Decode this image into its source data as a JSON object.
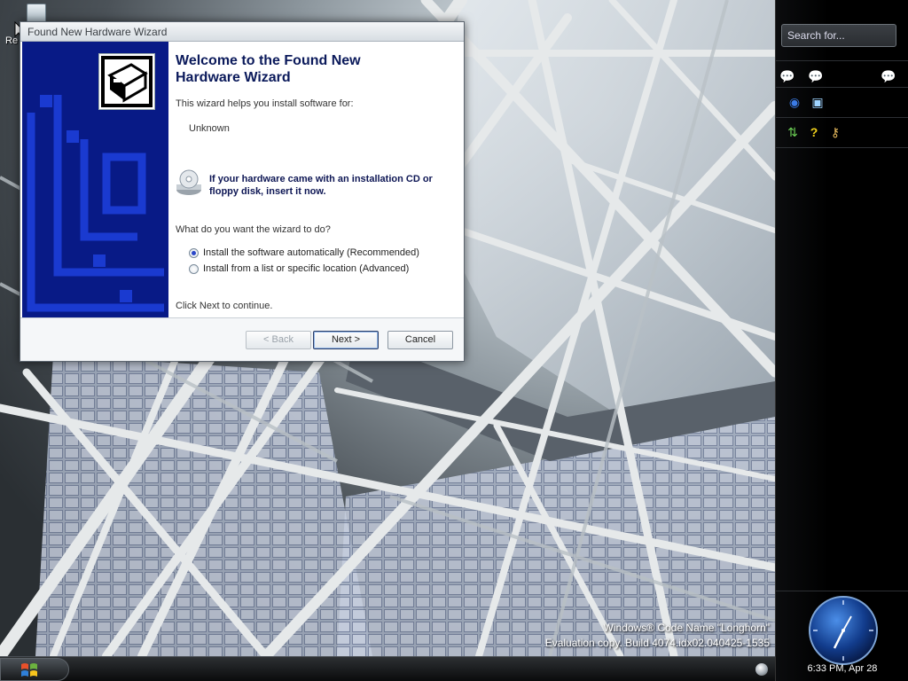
{
  "desktop": {
    "recycle_bin_label": "Re",
    "watermark_line1": "Windows® Code Name \"Longhorn\"",
    "watermark_line2": "Evaluation copy. Build 4074.idx02.040425-1535"
  },
  "wizard": {
    "window_title": "Found New Hardware Wizard",
    "heading": "Welcome to the Found New Hardware Wizard",
    "intro": "This wizard helps you install software for:",
    "device_name": "Unknown",
    "cd_hint": "If your hardware came with an installation CD or floppy disk, insert it now.",
    "question": "What do you want the wizard to do?",
    "options": [
      {
        "label": "Install the software automatically (Recommended)",
        "selected": true
      },
      {
        "label": "Install from a list or specific location (Advanced)",
        "selected": false
      }
    ],
    "continue_text": "Click Next to continue.",
    "buttons": {
      "back": "< Back",
      "next": "Next >",
      "cancel": "Cancel"
    }
  },
  "sidebar": {
    "search_placeholder": "Search for...",
    "icons_row1": [
      "chat-bubble-icon",
      "chat-bubble-icon",
      "chat-bubble-icon"
    ],
    "icons_row2": [
      "network-icon",
      "notes-icon"
    ],
    "icons_row3": [
      "transfer-icon",
      "help-icon",
      "keys-icon"
    ],
    "clock_time": "6:33 PM, Apr 28"
  },
  "taskbar": {
    "start_icon": "windows-logo-icon"
  },
  "colors": {
    "wizard_side_panel": "#081a86",
    "heading": "#0b1a5b",
    "sidebar_bg": "#000000"
  }
}
